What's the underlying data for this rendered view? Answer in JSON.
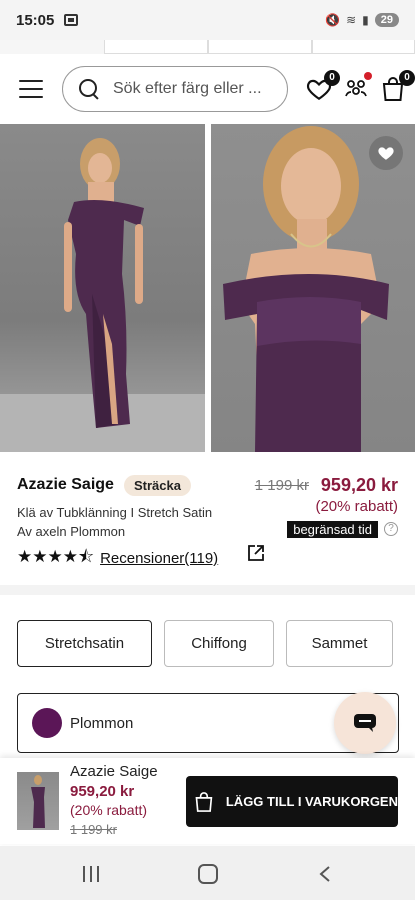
{
  "status_bar": {
    "time": "15:05",
    "battery": "29"
  },
  "header": {
    "search_placeholder": "Sök efter färg eller ...",
    "wishlist_count": "0",
    "cart_count": "0"
  },
  "product": {
    "name": "Azazie Saige",
    "tag": "Sträcka",
    "subtitle": "Klä av Tubklänning I Stretch Satin Av axeln Plommon",
    "rating_value": 4.5,
    "stars": "★★★★⯪",
    "reviews_label": "Recensioner(119)",
    "price_old": "1 199 kr",
    "price_new": "959,20 kr",
    "discount": "(20% rabatt)",
    "limited_label": "begränsad tid",
    "help_label": "?"
  },
  "fabrics": {
    "selected": "Stretchsatin",
    "options": [
      "Stretchsatin",
      "Chiffong",
      "Sammet"
    ]
  },
  "color": {
    "label": "Plommon",
    "swatch": "#5b1657"
  },
  "sticky": {
    "name": "Azazie Saige",
    "price": "959,20 kr",
    "discount": "(20% rabatt)",
    "price_old": "1 199 kr",
    "cart_label": "LÄGG TILL I VARUKORGEN"
  },
  "colors": {
    "accent_price": "#8a1b3e",
    "dress": "#4e2a4e",
    "button": "#111111",
    "tag_bg": "#f3e7da"
  }
}
